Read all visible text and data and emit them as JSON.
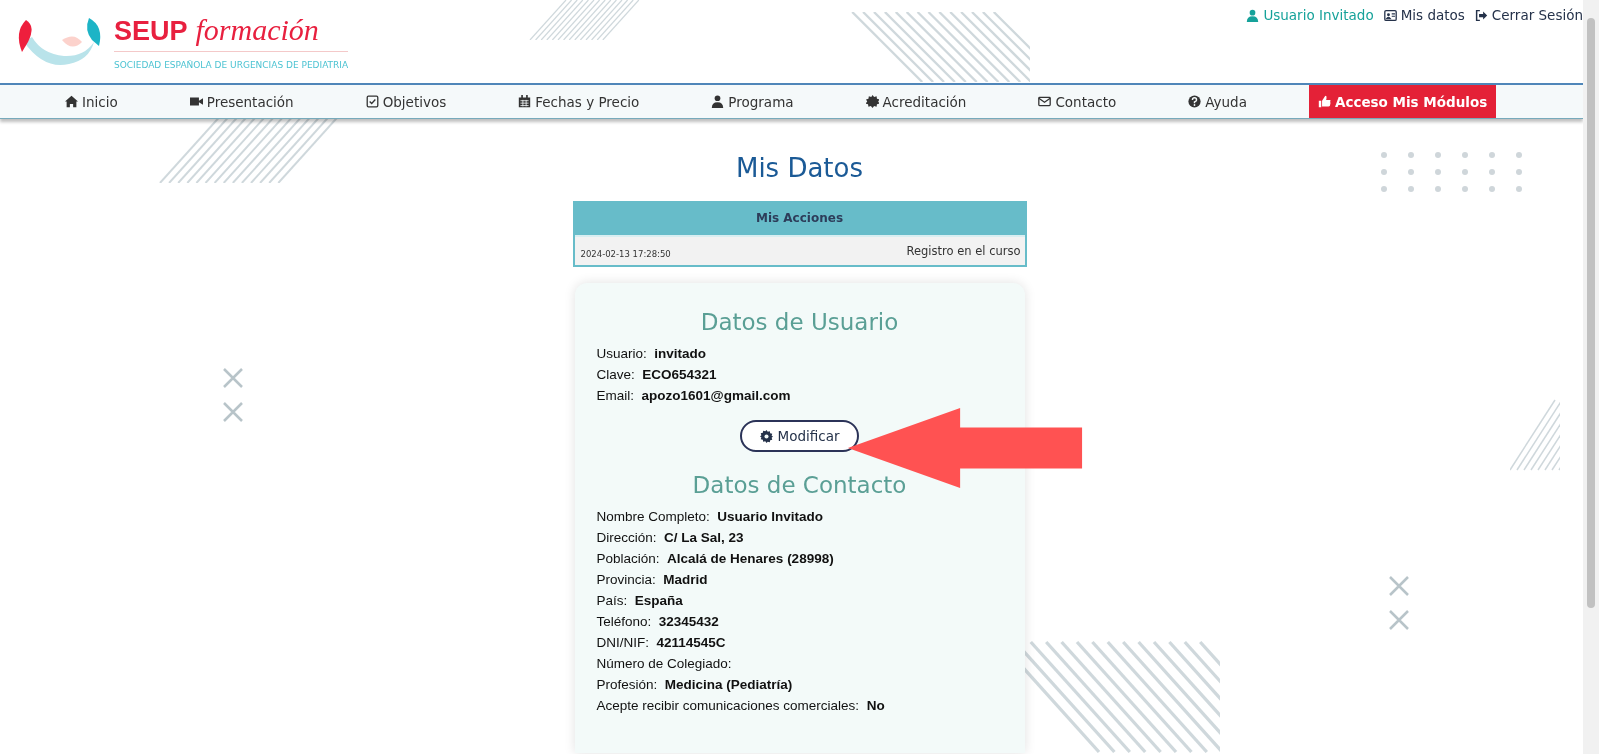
{
  "header": {
    "logo": {
      "brand": "SEUP",
      "script": "formación",
      "tagline": "SOCIEDAD ESPAÑOLA DE URGENCIAS DE PEDIATRIA"
    },
    "user_links": [
      {
        "kind": "user",
        "label": "Usuario Invitado"
      },
      {
        "kind": "profile",
        "label": "Mis datos"
      },
      {
        "kind": "logout",
        "label": "Cerrar Sesión"
      }
    ]
  },
  "nav": [
    {
      "label": "Inicio",
      "kind": "link"
    },
    {
      "label": "Presentación",
      "kind": "link"
    },
    {
      "label": "Objetivos",
      "kind": "link"
    },
    {
      "label": "Fechas y Precio",
      "kind": "link"
    },
    {
      "label": "Programa",
      "kind": "link"
    },
    {
      "label": "Acreditación",
      "kind": "link"
    },
    {
      "label": "Contacto",
      "kind": "link"
    },
    {
      "label": "Ayuda",
      "kind": "link"
    },
    {
      "label": "Acceso Mis Módulos",
      "kind": "highlight"
    }
  ],
  "page_title": "Mis Datos",
  "actions_table": {
    "heading": "Mis Acciones",
    "rows": [
      {
        "date": "2024-02-13 17:28:50",
        "action": "Registro en el curso"
      }
    ]
  },
  "user_section": {
    "heading": "Datos de Usuario",
    "fields": [
      {
        "label": "Usuario:",
        "value": "invitado"
      },
      {
        "label": "Clave:",
        "value": "ECO654321"
      },
      {
        "label": "Email:",
        "value": "apozo1601@gmail.com"
      }
    ],
    "button": "Modificar"
  },
  "contact_section": {
    "heading": "Datos de Contacto",
    "fields": [
      {
        "label": "Nombre Completo:",
        "value": "Usuario Invitado"
      },
      {
        "label": "Dirección:",
        "value": "C/ La Sal, 23"
      },
      {
        "label": "Población:",
        "value": "Alcalá de Henares (28998)"
      },
      {
        "label": "Provincia:",
        "value": "Madrid"
      },
      {
        "label": "País:",
        "value": "España"
      },
      {
        "label": "Teléfono:",
        "value": "32345432"
      },
      {
        "label": "DNI/NIF:",
        "value": "42114545C"
      },
      {
        "label": "Número de Colegiado:"
      },
      {
        "label": "Profesión:",
        "value": "Medicina (Pediatría)"
      },
      {
        "label": "Acepte recibir comunicaciones comerciales:",
        "value": "No"
      }
    ]
  }
}
